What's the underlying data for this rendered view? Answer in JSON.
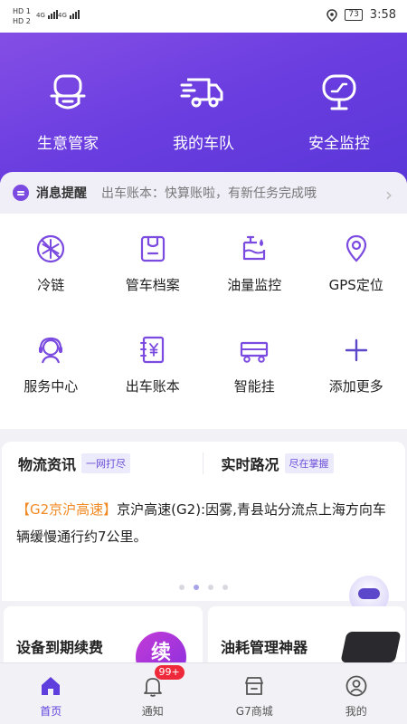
{
  "status_bar": {
    "hd1": "HD 1",
    "hd2": "HD 2",
    "net1": "4G",
    "net2": "4G",
    "battery": "73",
    "time": "3:58"
  },
  "top_nav": [
    {
      "label": "生意管家",
      "icon": "manager-icon"
    },
    {
      "label": "我的车队",
      "icon": "truck-icon"
    },
    {
      "label": "安全监控",
      "icon": "monitor-icon"
    }
  ],
  "notice": {
    "title": "消息提醒",
    "message": "出车账本：快算账啦，有新任务完成哦"
  },
  "grid": [
    {
      "label": "冷链",
      "icon": "snowflake-icon"
    },
    {
      "label": "管车档案",
      "icon": "archive-icon"
    },
    {
      "label": "油量监控",
      "icon": "fuel-icon"
    },
    {
      "label": "GPS定位",
      "icon": "location-pin-icon"
    },
    {
      "label": "服务中心",
      "icon": "headset-icon"
    },
    {
      "label": "出车账本",
      "icon": "ledger-icon"
    },
    {
      "label": "智能挂",
      "icon": "trailer-icon"
    },
    {
      "label": "添加更多",
      "icon": "plus-icon"
    }
  ],
  "news": {
    "left_title": "物流资讯",
    "left_tag": "一网打尽",
    "right_title": "实时路况",
    "right_tag": "尽在掌握",
    "road_tag": "【G2京沪高速】",
    "content": "京沪高速(G2):因雾,青县站分流点上海方向车辆缓慢通行约7公里。"
  },
  "promos": {
    "left": "设备到期续费",
    "left_badge": "续",
    "right": "油耗管理神器"
  },
  "tabbar": [
    {
      "label": "首页",
      "icon": "home-icon"
    },
    {
      "label": "通知",
      "icon": "bell-icon",
      "badge": "99+"
    },
    {
      "label": "G7商城",
      "icon": "store-icon"
    },
    {
      "label": "我的",
      "icon": "user-icon"
    }
  ],
  "colors": {
    "brand": "#6a3de0",
    "accent_orange": "#f28a23",
    "badge_red": "#ee2a3a"
  }
}
